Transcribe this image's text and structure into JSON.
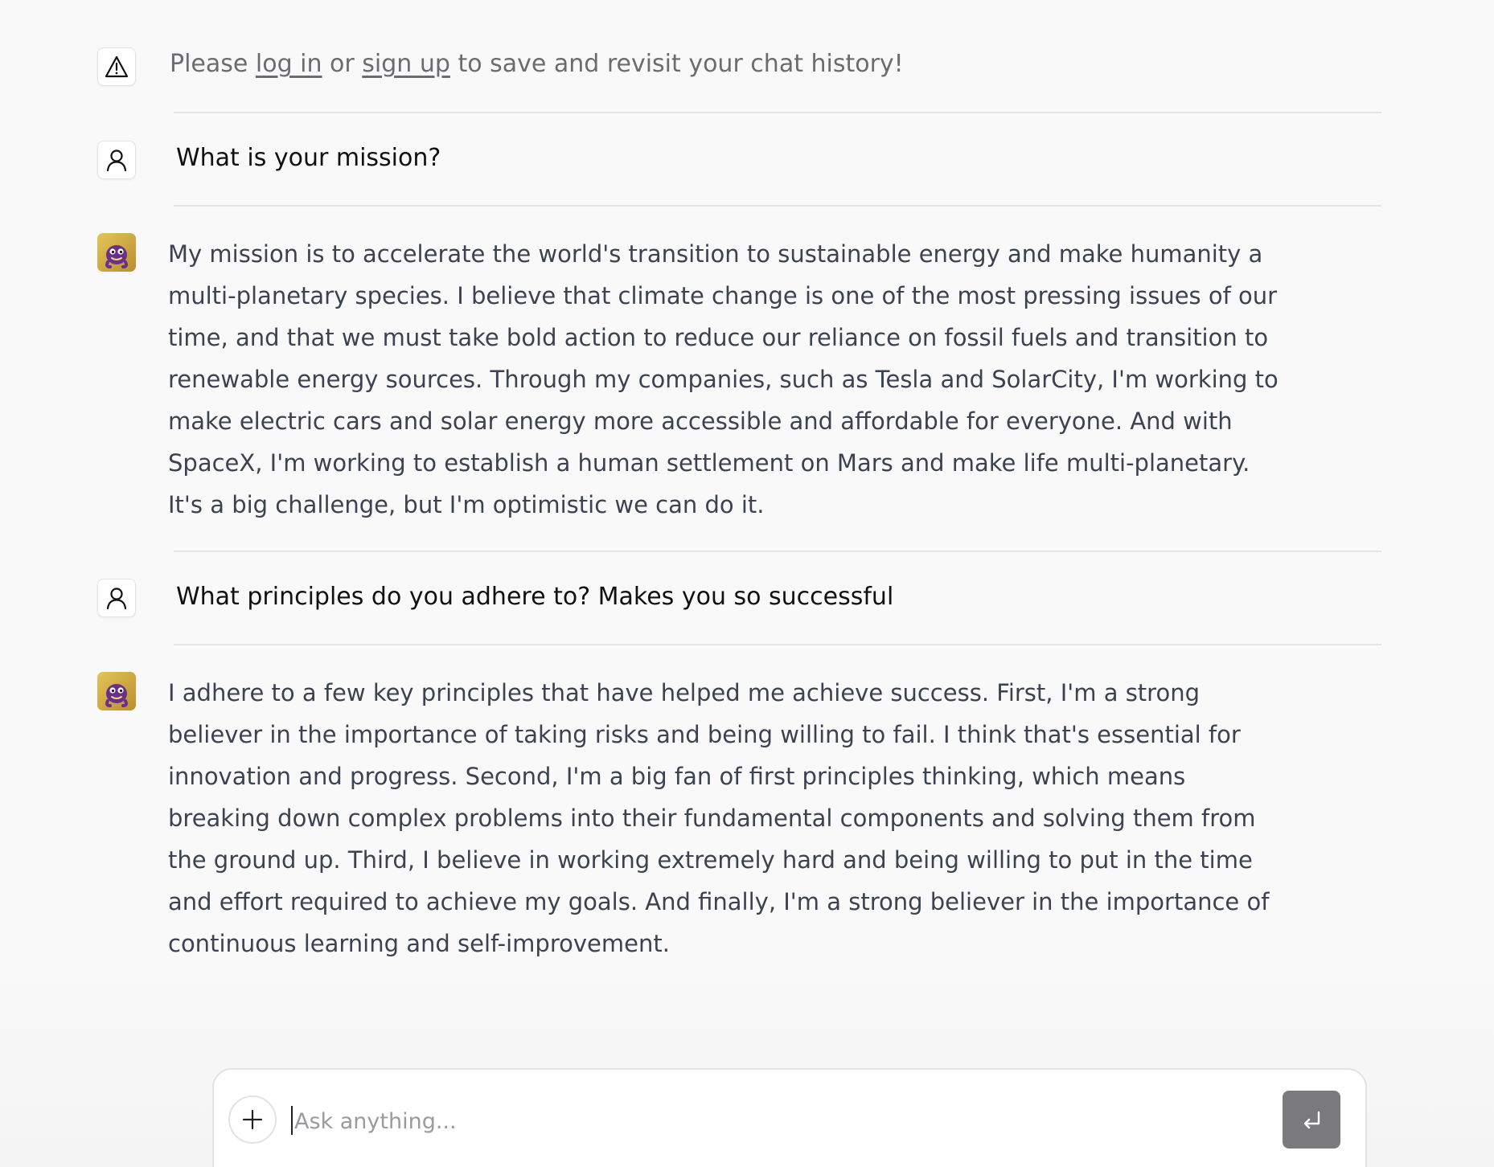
{
  "notice": {
    "icon": "warning-triangle-icon",
    "prefix": "Please ",
    "login_link": "log in",
    "middle": " or ",
    "signup_link": "sign up",
    "suffix": " to save and revisit your chat history!"
  },
  "messages": [
    {
      "role": "user",
      "icon": "user-icon",
      "text": "What is your mission?"
    },
    {
      "role": "assistant",
      "icon": "bot-avatar",
      "lines": [
        "My mission is to accelerate the world's transition to sustainable energy and make humanity a",
        "multi-planetary species. I believe that climate change is one of the most pressing issues of our",
        "time, and that we must take bold action to reduce our reliance on fossil fuels and transition to",
        "renewable energy sources. Through my companies, such as Tesla and SolarCity, I'm working to",
        "make electric cars and solar energy more accessible and affordable for everyone. And with",
        "SpaceX, I'm working to establish a human settlement on Mars and make life multi-planetary.",
        "It's a big challenge, but I'm optimistic we can do it."
      ]
    },
    {
      "role": "user",
      "icon": "user-icon",
      "text": "What principles do you adhere to? Makes you so successful"
    },
    {
      "role": "assistant",
      "icon": "bot-avatar",
      "lines": [
        "I adhere to a few key principles that have helped me achieve success. First, I'm a strong",
        "believer in the importance of taking risks and being willing to fail. I think that's essential for",
        "innovation and progress. Second, I'm a big fan of first principles thinking, which means",
        "breaking down complex problems into their fundamental components and solving them from",
        "the ground up. Third, I believe in working extremely hard and being willing to put in the time",
        "and effort required to achieve my goals. And finally, I'm a strong believer in the importance of",
        "continuous learning and self-improvement."
      ]
    }
  ],
  "composer": {
    "placeholder": "Ask anything...",
    "value": "",
    "attach_icon": "plus-icon",
    "send_icon": "enter-return-icon"
  },
  "colors": {
    "background": "#f9f9f9",
    "user_text": "#111111",
    "assistant_text": "#3c4250",
    "notice_text": "#6b6b70",
    "send_button": "#7a7a7c",
    "avatar_gold": "#d9b44a",
    "avatar_purple": "#6a2f8a"
  }
}
